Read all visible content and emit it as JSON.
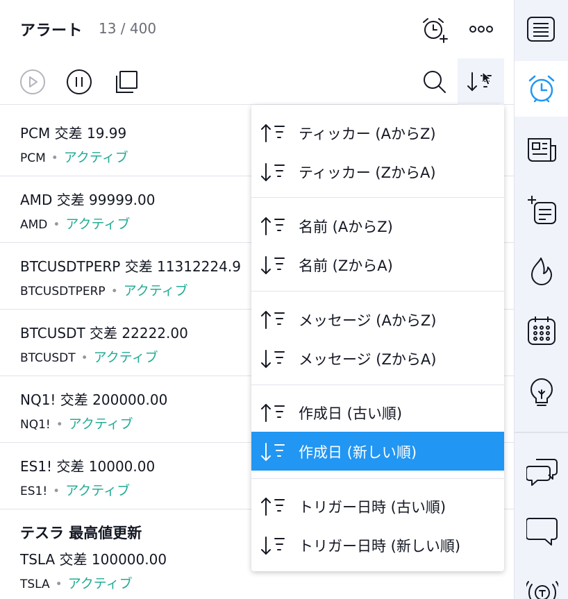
{
  "header": {
    "title": "アラート",
    "count": "13 / 400"
  },
  "alerts": [
    {
      "name": "PCM 交差 19.99",
      "ticker": "PCM",
      "status": "アクティブ"
    },
    {
      "name": "AMD 交差 99999.00",
      "ticker": "AMD",
      "status": "アクティブ"
    },
    {
      "name": "BTCUSDTPERP 交差 11312224.9",
      "ticker": "BTCUSDTPERP",
      "status": "アクティブ"
    },
    {
      "name": "BTCUSDT 交差 22222.00",
      "ticker": "BTCUSDT",
      "status": "アクティブ"
    },
    {
      "name": "NQ1! 交差 200000.00",
      "ticker": "NQ1!",
      "status": "アクティブ"
    },
    {
      "name": "ES1! 交差 10000.00",
      "ticker": "ES1!",
      "status": "アクティブ"
    },
    {
      "heading": "テスラ 最高値更新",
      "name": "TSLA 交差 100000.00",
      "ticker": "TSLA",
      "status": "アクティブ"
    }
  ],
  "sort_menu": {
    "items": [
      {
        "label": "ティッカー (AからZ)",
        "direction": "asc"
      },
      {
        "label": "ティッカー (ZからA)",
        "direction": "desc"
      },
      {
        "label": "名前 (AからZ)",
        "direction": "asc"
      },
      {
        "label": "名前 (ZからA)",
        "direction": "desc"
      },
      {
        "label": "メッセージ (AからZ)",
        "direction": "asc"
      },
      {
        "label": "メッセージ (ZからA)",
        "direction": "desc"
      },
      {
        "label": "作成日 (古い順)",
        "direction": "asc"
      },
      {
        "label": "作成日 (新しい順)",
        "direction": "desc",
        "selected": true
      },
      {
        "label": "トリガー日時 (古い順)",
        "direction": "asc"
      },
      {
        "label": "トリガー日時 (新しい順)",
        "direction": "desc"
      }
    ]
  },
  "icons": {
    "header": [
      "add-alert-icon",
      "more-icon"
    ],
    "toolbar": [
      "play-icon",
      "pause-icon",
      "copy-icon",
      "search-icon",
      "sort-icon"
    ],
    "sidebar": [
      "watchlist-icon",
      "alarm-clock-icon",
      "news-icon",
      "data-window-icon",
      "hotlist-icon",
      "calendar-icon",
      "ideas-icon",
      "chat-icon",
      "chats-icon",
      "stream-icon"
    ]
  },
  "colors": {
    "accent": "#2196f3",
    "status_active": "#22ab94",
    "sidebar_bg": "#f0f3fa"
  }
}
